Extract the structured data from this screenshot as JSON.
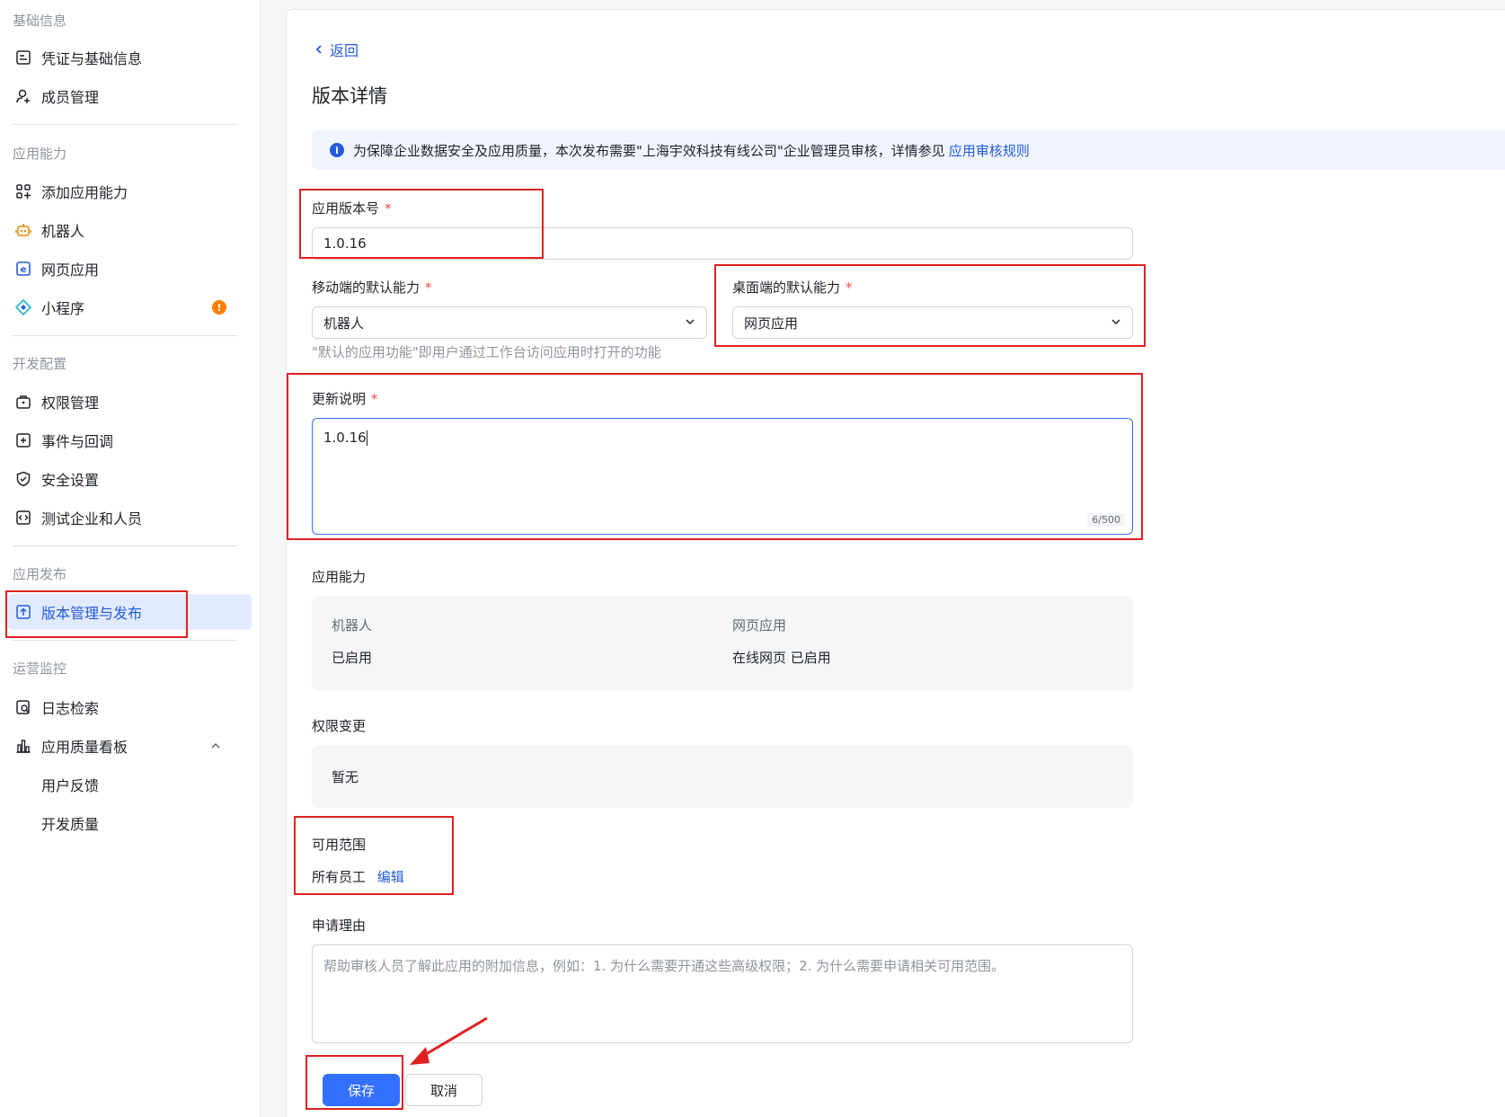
{
  "sidebar": {
    "sections": [
      {
        "title": "基础信息",
        "items": [
          {
            "label": "凭证与基础信息"
          },
          {
            "label": "成员管理"
          }
        ]
      },
      {
        "title": "应用能力",
        "items": [
          {
            "label": "添加应用能力"
          },
          {
            "label": "机器人"
          },
          {
            "label": "网页应用"
          },
          {
            "label": "小程序",
            "badge": "!"
          }
        ]
      },
      {
        "title": "开发配置",
        "items": [
          {
            "label": "权限管理"
          },
          {
            "label": "事件与回调"
          },
          {
            "label": "安全设置"
          },
          {
            "label": "测试企业和人员"
          }
        ]
      },
      {
        "title": "应用发布",
        "items": [
          {
            "label": "版本管理与发布"
          }
        ]
      },
      {
        "title": "运营监控",
        "items": [
          {
            "label": "日志检索"
          },
          {
            "label": "应用质量看板"
          },
          {
            "label": "用户反馈"
          },
          {
            "label": "开发质量"
          }
        ]
      }
    ]
  },
  "main": {
    "back_label": "返回",
    "title": "版本详情",
    "notice": {
      "text": "为保障企业数据安全及应用质量，本次发布需要\"上海宇效科技有线公司\"企业管理员审核，详情参见",
      "link": "应用审核规则",
      "icon": "info-icon"
    },
    "version": {
      "label": "应用版本号",
      "required": "*",
      "value": "1.0.16"
    },
    "mobile_default": {
      "label": "移动端的默认能力",
      "required": "*",
      "value": "机器人",
      "hint": "\"默认的应用功能\"即用户通过工作台访问应用时打开的功能"
    },
    "desktop_default": {
      "label": "桌面端的默认能力",
      "required": "*",
      "value": "网页应用"
    },
    "update_notes": {
      "label": "更新说明",
      "required": "*",
      "value": "1.0.16",
      "counter": "6/500"
    },
    "capabilities": {
      "label": "应用能力",
      "items": [
        {
          "name": "机器人",
          "status": "已启用"
        },
        {
          "name": "网页应用",
          "status": "在线网页 已启用"
        }
      ]
    },
    "permissions": {
      "label": "权限变更",
      "value": "暂无"
    },
    "scope": {
      "label": "可用范围",
      "value": "所有员工",
      "edit_label": "编辑"
    },
    "reason": {
      "label": "申请理由",
      "placeholder": "帮助审核人员了解此应用的附加信息，例如：1. 为什么需要开通这些高级权限；2. 为什么需要申请相关可用范围。"
    },
    "save_label": "保存",
    "cancel_label": "取消"
  },
  "colors": {
    "accent": "#3370ff",
    "annotation": "#e02020",
    "required": "#f54a45",
    "badge": "#ff7d00"
  }
}
